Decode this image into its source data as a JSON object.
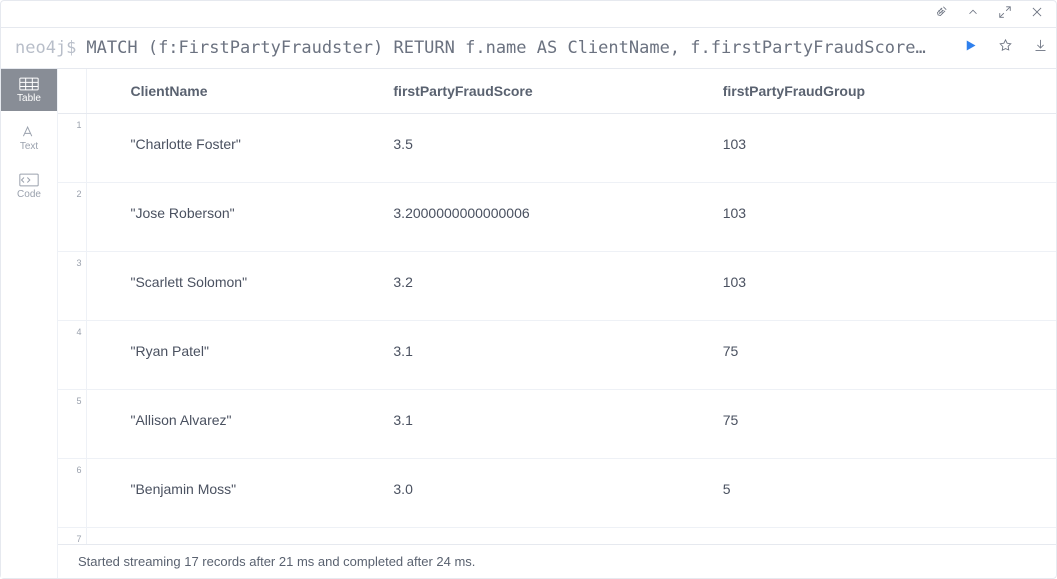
{
  "editor": {
    "prompt": "neo4j$",
    "query": "MATCH (f:FirstPartyFraudster) RETURN f.name AS ClientName, f.firstPartyFraudScore…"
  },
  "sidebar": {
    "table": "Table",
    "text": "Text",
    "code": "Code"
  },
  "columns": [
    "ClientName",
    "firstPartyFraudScore",
    "firstPartyFraudGroup"
  ],
  "rows": [
    {
      "idx": "1",
      "ClientName": "\"Charlotte Foster\"",
      "firstPartyFraudScore": "3.5",
      "firstPartyFraudGroup": "103"
    },
    {
      "idx": "2",
      "ClientName": "\"Jose Roberson\"",
      "firstPartyFraudScore": "3.2000000000000006",
      "firstPartyFraudGroup": "103"
    },
    {
      "idx": "3",
      "ClientName": "\"Scarlett Solomon\"",
      "firstPartyFraudScore": "3.2",
      "firstPartyFraudGroup": "103"
    },
    {
      "idx": "4",
      "ClientName": "\"Ryan Patel\"",
      "firstPartyFraudScore": "3.1",
      "firstPartyFraudGroup": "75"
    },
    {
      "idx": "5",
      "ClientName": "\"Allison Alvarez\"",
      "firstPartyFraudScore": "3.1",
      "firstPartyFraudGroup": "75"
    },
    {
      "idx": "6",
      "ClientName": "\"Benjamin Moss\"",
      "firstPartyFraudScore": "3.0",
      "firstPartyFraudGroup": "5"
    },
    {
      "idx": "7",
      "ClientName": "",
      "firstPartyFraudScore": "",
      "firstPartyFraudGroup": ""
    }
  ],
  "footer": {
    "status": "Started streaming 17 records after 21 ms and completed after 24 ms."
  }
}
